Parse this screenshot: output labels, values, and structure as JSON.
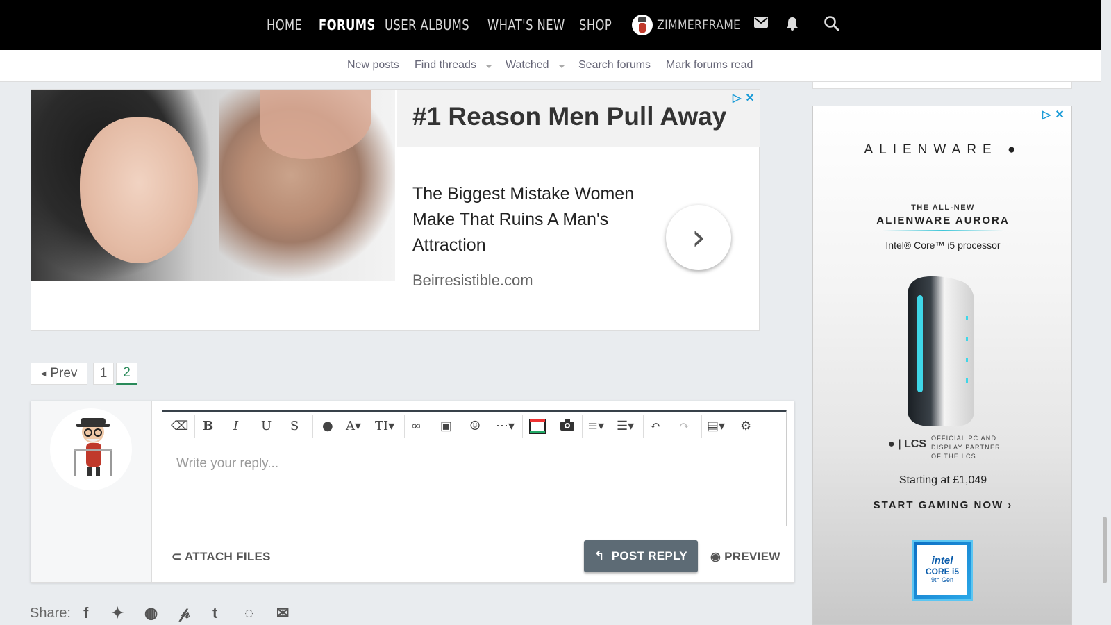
{
  "topnav": {
    "home": "HOME",
    "forums": "FORUMS",
    "user_albums": "USER ALBUMS",
    "whats_new": "WHAT'S NEW",
    "shop": "SHOP",
    "username": "ZIMMERFRAME"
  },
  "subnav": {
    "new_posts": "New posts",
    "find_threads": "Find threads",
    "watched": "Watched",
    "search_forums": "Search forums",
    "mark_read": "Mark forums read"
  },
  "ad1": {
    "headline": "#1 Reason Men Pull Away",
    "body": "The Biggest Mistake Women Make That Ruins A Man's Attraction",
    "domain": "Beirresistible.com",
    "arrow": "›"
  },
  "pagination": {
    "prev": "Prev",
    "pages": [
      "1",
      "2"
    ],
    "current": "2"
  },
  "reply": {
    "placeholder": "Write your reply...",
    "attach_label": "ATTACH FILES",
    "post_label": "POST REPLY",
    "preview_label": "PREVIEW"
  },
  "share": {
    "label": "Share:",
    "networks": [
      "facebook-icon",
      "twitter-icon",
      "reddit-icon",
      "pinterest-icon",
      "tumblr-icon",
      "whatsapp-icon",
      "email-icon"
    ]
  },
  "ad2": {
    "brand": "ALIENWARE",
    "kicker": "THE ALL-NEW",
    "product": "ALIENWARE AURORA",
    "processor": "Intel® Core™ i5 processor",
    "partner": [
      "OFFICIAL PC AND",
      "DISPLAY PARTNER",
      "OF THE LCS"
    ],
    "lcs": "LCS",
    "price": "Starting at £1,049",
    "cta": "START GAMING NOW ›",
    "intel_brand": "intel",
    "intel_chip": "CORE i5",
    "intel_gen": "9th Gen"
  },
  "colors": {
    "nav_bg": "#000000",
    "accent": "#2a8a5a",
    "button": "#5d6b75",
    "ad_choice": "#1a9bd7"
  }
}
